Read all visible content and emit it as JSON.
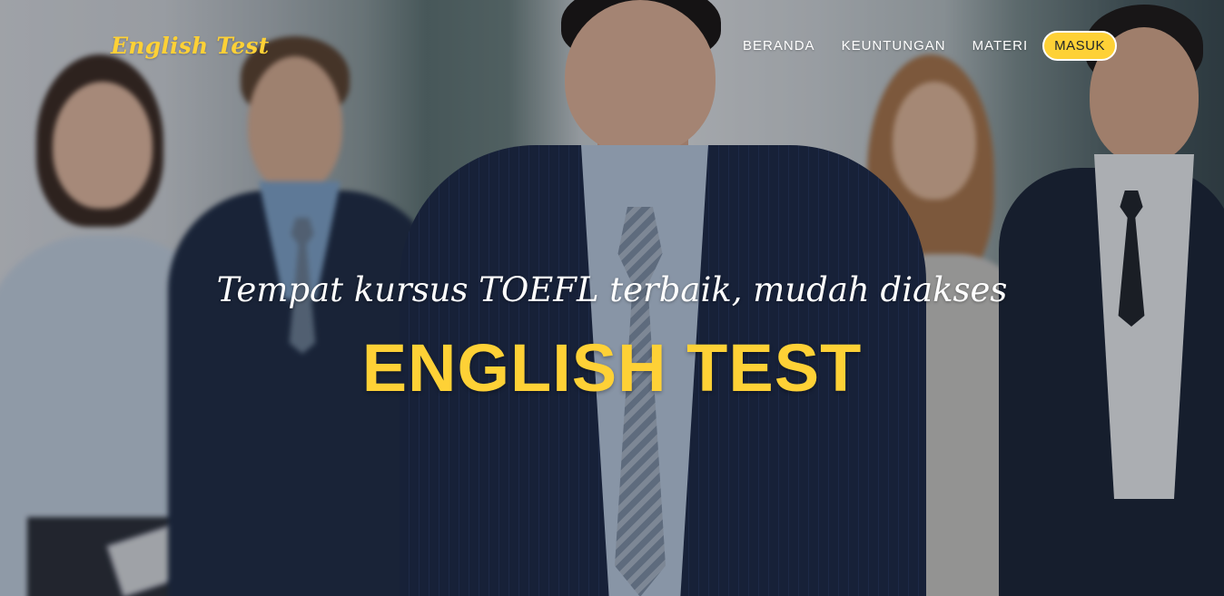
{
  "navbar": {
    "brand": "English Test",
    "links": [
      {
        "label": "BERANDA"
      },
      {
        "label": "KEUNTUNGAN"
      },
      {
        "label": "MATERI"
      }
    ],
    "login_label": "MASUK"
  },
  "hero": {
    "subheading": "Tempat kursus TOEFL terbaik, mudah diakses",
    "heading": "ENGLISH TEST"
  },
  "colors": {
    "accent": "#fed136",
    "text_light": "#ffffff",
    "button_text": "#212529"
  }
}
